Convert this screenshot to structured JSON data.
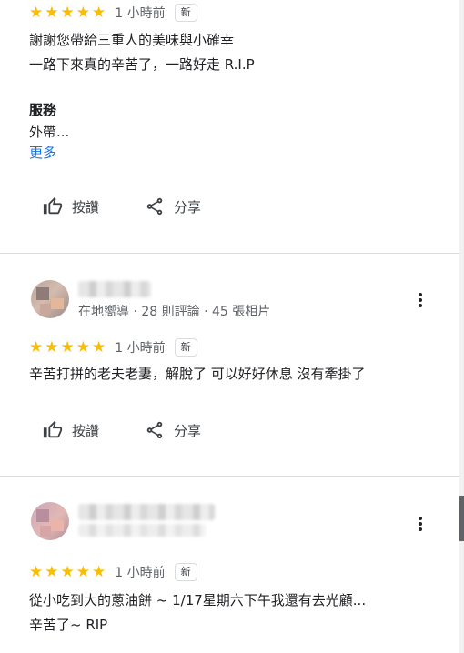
{
  "reviews": [
    {
      "time": "1 小時前",
      "badge": "新",
      "lines": [
        "謝謝您帶給三重人的美味與小確幸",
        "一路下來真的辛苦了，一路好走 R.I.P"
      ],
      "service_title": "服務",
      "service_value": "外帶...",
      "more": "更多",
      "like": "按讚",
      "share": "分享"
    },
    {
      "meta": "在地嚮導 · 28 則評論 · 45 張相片",
      "time": "1 小時前",
      "badge": "新",
      "lines": [
        "辛苦打拼的老夫老妻，解脫了 可以好好休息  沒有牽掛了"
      ],
      "like": "按讚",
      "share": "分享"
    },
    {
      "time": "1 小時前",
      "badge": "新",
      "lines": [
        "從小吃到大的蔥油餅 ~ 1/17星期六下午我還有去光顧...",
        "辛苦了~ RIP"
      ]
    }
  ],
  "rating_stars": 5,
  "colors": {
    "star": "#fbbc04",
    "link": "#1a73e8",
    "divider": "#dadce0"
  }
}
